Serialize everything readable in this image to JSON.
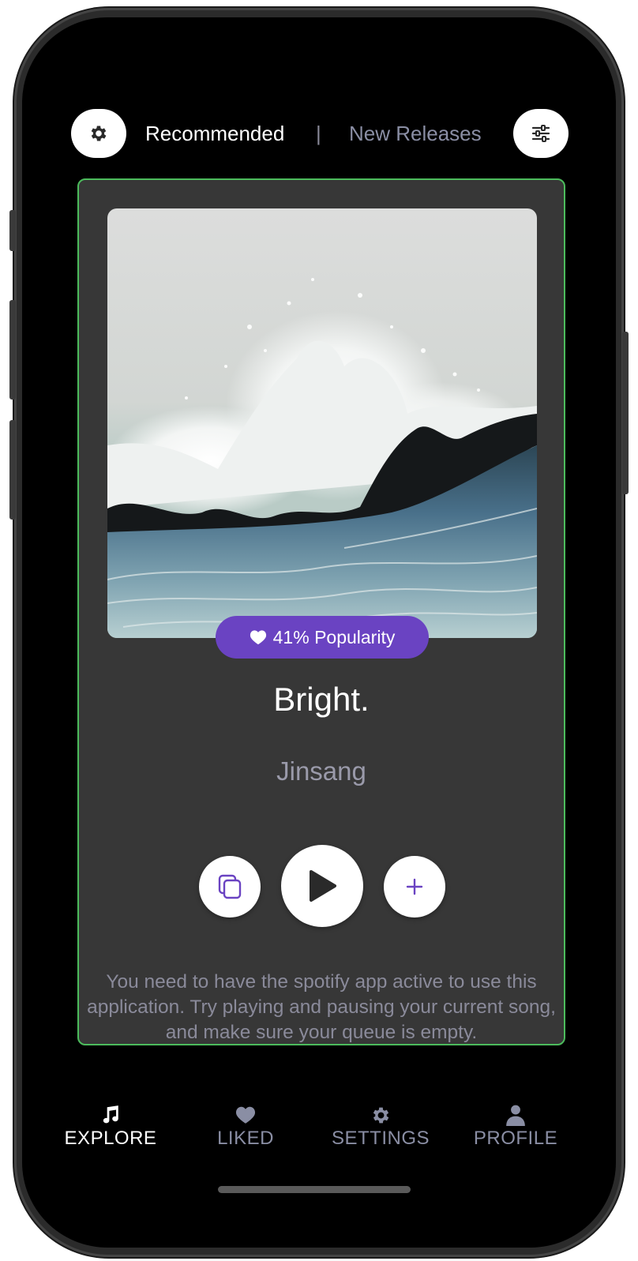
{
  "header": {
    "tab_recommended": "Recommended",
    "separator": "|",
    "tab_new_releases": "New Releases",
    "settings_icon": "gear-icon",
    "filter_icon": "sliders-icon"
  },
  "track": {
    "popularity_label": "41% Popularity",
    "popularity": 0.41,
    "title": "Bright.",
    "artist": "Jinsang"
  },
  "controls": {
    "queue_icon": "copy-icon",
    "play_icon": "play-icon",
    "add_icon": "plus-icon"
  },
  "notice": "You need to have the spotify app active to use this application. Try playing and pausing your current song, and make sure your queue is empty.",
  "nav": {
    "items": [
      {
        "label": "EXPLORE",
        "icon": "music-note-icon",
        "active": true
      },
      {
        "label": "LIKED",
        "icon": "heart-icon",
        "active": false
      },
      {
        "label": "SETTINGS",
        "icon": "gear-icon",
        "active": false
      },
      {
        "label": "PROFILE",
        "icon": "person-icon",
        "active": false
      }
    ]
  },
  "colors": {
    "accent": "#6a43c2",
    "card_border": "#4cbb5c",
    "card_bg": "#373737",
    "muted_text": "#8a8ea4"
  }
}
